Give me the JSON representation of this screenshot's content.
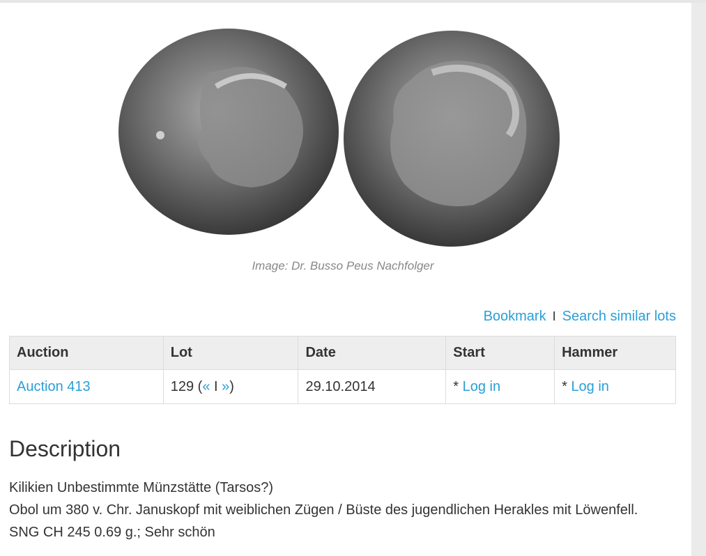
{
  "image_credit": "Image: Dr. Busso Peus Nachfolger",
  "actions": {
    "bookmark": "Bookmark",
    "separator": "I",
    "search_similar": "Search similar lots"
  },
  "table": {
    "headers": [
      "Auction",
      "Lot",
      "Date",
      "Start",
      "Hammer"
    ],
    "row": {
      "auction": "Auction 413",
      "lot_number": "129 (",
      "lot_prev": "«",
      "lot_sep": " I ",
      "lot_next": "»",
      "lot_close": ")",
      "date": "29.10.2014",
      "start_prefix": "* ",
      "start_link": "Log in",
      "hammer_prefix": "* ",
      "hammer_link": "Log in"
    }
  },
  "description": {
    "title": "Description",
    "lines": [
      "Kilikien Unbestimmte Münzstätte (Tarsos?)",
      "Obol um 380 v. Chr. Januskopf mit weiblichen Zügen / Büste des jugendlichen Herakles mit Löwenfell.",
      "SNG CH 245 0.69 g.; Sehr schön"
    ]
  },
  "colors": {
    "link": "#2a9fd6",
    "header_bg": "#eeeeee",
    "page_bg": "#ebebeb"
  }
}
